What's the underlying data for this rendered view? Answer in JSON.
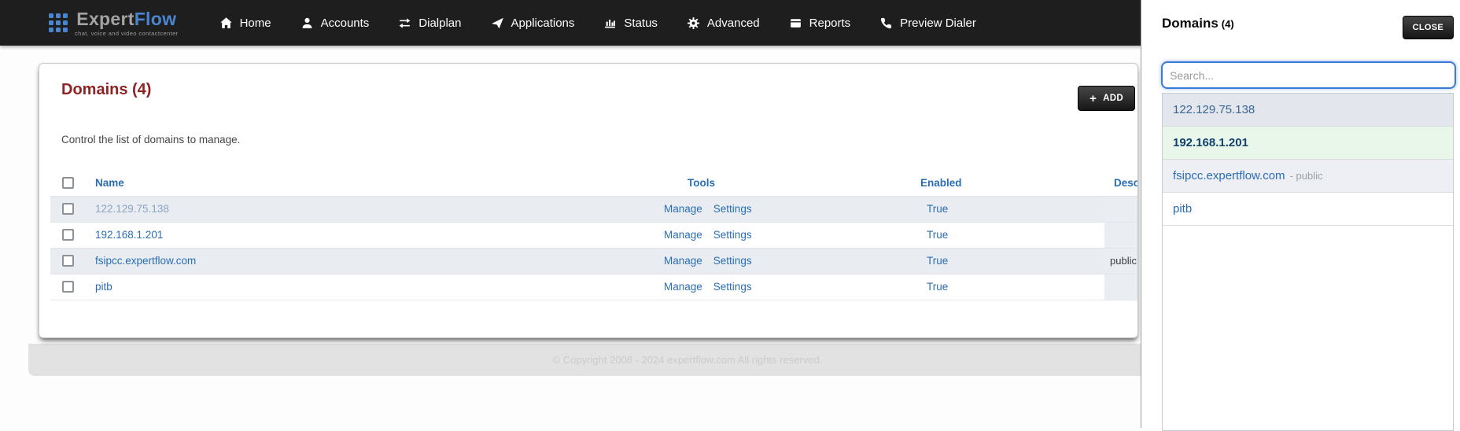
{
  "navbar": {
    "brand": {
      "expert": "Expert",
      "flow": "Flow",
      "tagline": "chat, voice and video contactcenter"
    },
    "items": [
      {
        "label": "Home",
        "icon": "home-icon"
      },
      {
        "label": "Accounts",
        "icon": "user-icon"
      },
      {
        "label": "Dialplan",
        "icon": "transfer-arrows-icon"
      },
      {
        "label": "Applications",
        "icon": "paper-plane-icon"
      },
      {
        "label": "Status",
        "icon": "bar-chart-icon"
      },
      {
        "label": "Advanced",
        "icon": "gear-icon"
      },
      {
        "label": "Reports",
        "icon": "book-icon"
      },
      {
        "label": "Preview Dialer",
        "icon": "phone-icon"
      }
    ]
  },
  "main": {
    "title": "Domains (4)",
    "subtitle": "Control the list of domains to manage.",
    "add_button": {
      "plus": "+",
      "label": "ADD"
    },
    "table": {
      "headers": {
        "name": "Name",
        "tools": "Tools",
        "enabled": "Enabled",
        "description": "Description"
      },
      "rows": [
        {
          "name": "122.129.75.138",
          "tools": [
            "Manage",
            "Settings"
          ],
          "enabled": "True",
          "description": ""
        },
        {
          "name": "192.168.1.201",
          "tools": [
            "Manage",
            "Settings"
          ],
          "enabled": "True",
          "description": ""
        },
        {
          "name": "fsipcc.expertflow.com",
          "tools": [
            "Manage",
            "Settings"
          ],
          "enabled": "True",
          "description": "public"
        },
        {
          "name": "pitb",
          "tools": [
            "Manage",
            "Settings"
          ],
          "enabled": "True",
          "description": ""
        }
      ]
    },
    "footer_text": "© Copyright 2008 - 2024 expertflow.com All rights reserved."
  },
  "panel": {
    "title": "Domains",
    "count": "(4)",
    "close_button": "CLOSE",
    "search_placeholder": "Search...",
    "items": [
      {
        "label": "122.129.75.138",
        "suffix": "",
        "state": "hover"
      },
      {
        "label": "192.168.1.201",
        "suffix": "",
        "state": "selected"
      },
      {
        "label": "fsipcc.expertflow.com",
        "suffix": "- public",
        "state": "striped"
      },
      {
        "label": "pitb",
        "suffix": "",
        "state": "default"
      }
    ]
  },
  "colors": {
    "navbar_bg": "#1e1e1e",
    "brand_blue": "#4a86d0",
    "heading_maroon": "#8e2323",
    "link_blue": "#2a6db5",
    "stripe_row": "#e9edf2",
    "selected_green": "#e9f7ea",
    "dark_button": "#1a1a1a",
    "search_focus_blue": "#3b7ad6"
  }
}
